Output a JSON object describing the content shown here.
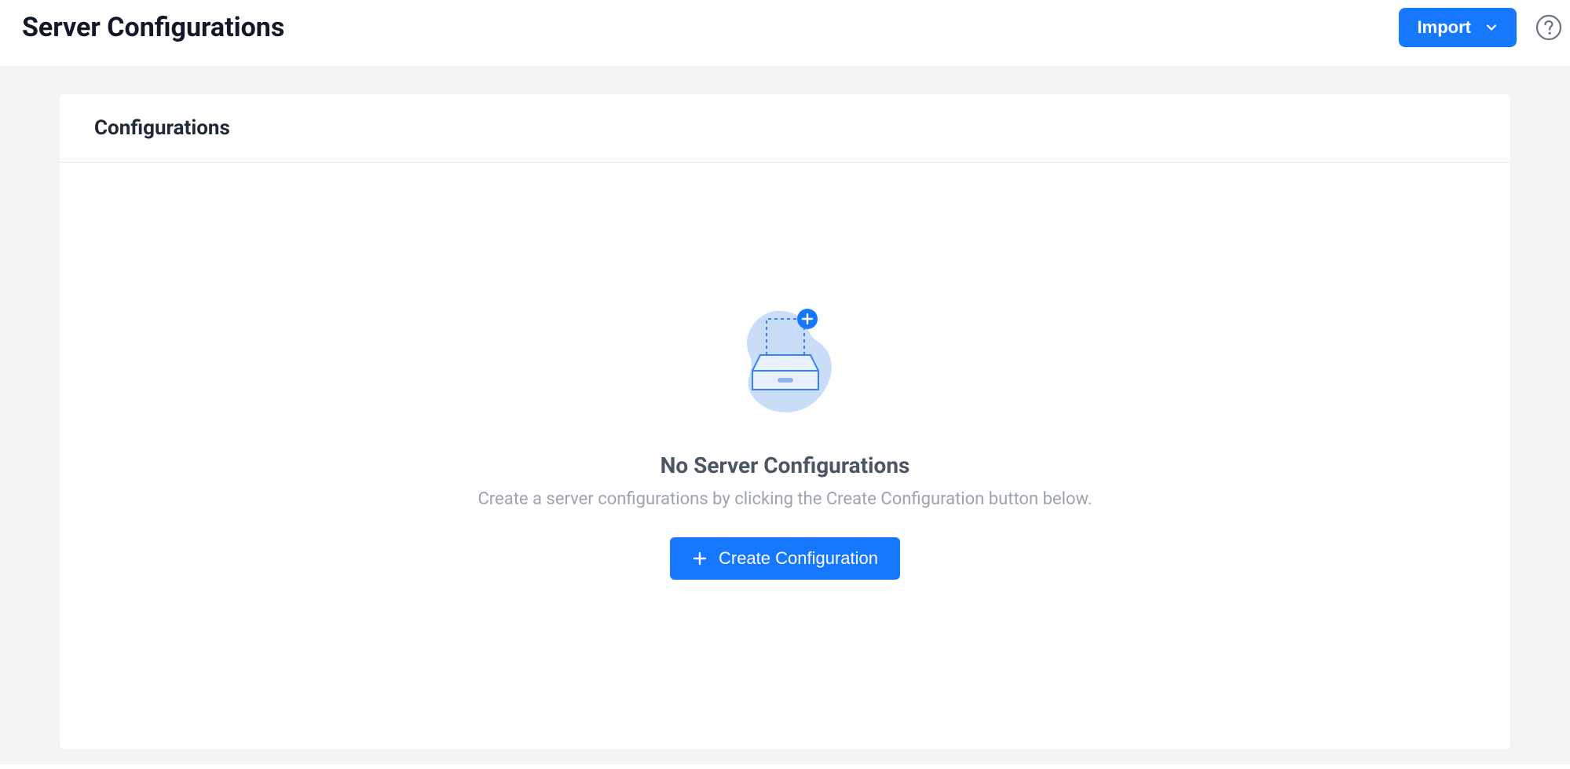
{
  "header": {
    "title": "Server Configurations",
    "import_label": "Import"
  },
  "card": {
    "title": "Configurations"
  },
  "empty": {
    "title": "No Server Configurations",
    "description": "Create a server configurations by clicking the Create Configuration button below.",
    "create_label": "Create Configuration"
  }
}
